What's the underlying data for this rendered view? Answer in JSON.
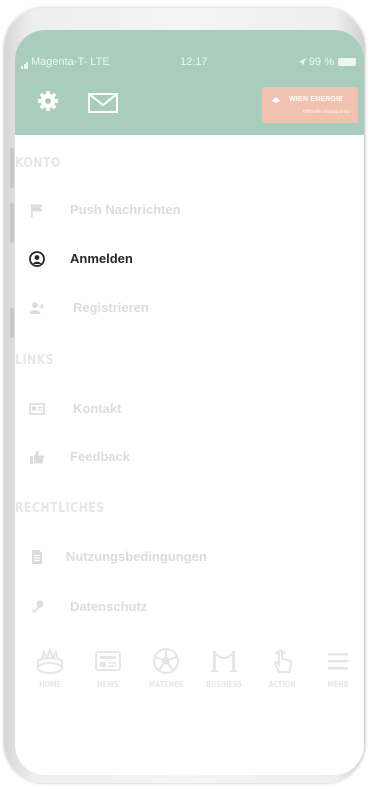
{
  "status_bar": {
    "carrier": "Magenta-T- LTE",
    "time": "12:17",
    "battery": "99 %"
  },
  "header": {
    "sponsor_logo": {
      "name": "WIEN ENERGIE",
      "subtitle": "Offizieller Hauptsponsor"
    }
  },
  "menu": {
    "sections": [
      {
        "title": "KONTO",
        "items": [
          {
            "label": "Push Nachrichten",
            "icon": "flag-icon",
            "active": false
          },
          {
            "label": "Anmelden",
            "icon": "user-circle-icon",
            "active": true
          },
          {
            "label": "Registrieren",
            "icon": "add-user-icon",
            "active": false
          }
        ]
      },
      {
        "title": "LINKS",
        "items": [
          {
            "label": "Kontakt",
            "icon": "contact-card-icon",
            "active": false
          },
          {
            "label": "Feedback",
            "icon": "thumbs-up-icon",
            "active": false
          }
        ]
      },
      {
        "title": "RECHTLICHES",
        "items": [
          {
            "label": "Nutzungsbedingungen",
            "icon": "document-icon",
            "active": false
          },
          {
            "label": "Datenschutz",
            "icon": "key-icon",
            "active": false
          }
        ]
      }
    ]
  },
  "tabbar": [
    {
      "label": "HOME",
      "icon": "stadium-icon"
    },
    {
      "label": "NEWS",
      "icon": "newspaper-icon"
    },
    {
      "label": "MATCHES",
      "icon": "soccer-ball-icon"
    },
    {
      "label": "BUSINESS",
      "icon": "barrier-rope-icon"
    },
    {
      "label": "ACTION",
      "icon": "tap-hand-icon"
    },
    {
      "label": "MEHR",
      "icon": "hamburger-menu-icon"
    }
  ],
  "colors": {
    "header_bg": "#a9cdbd",
    "active_text": "#262626",
    "inactive_text": "#dcdcdc",
    "logo_bg": "#f1c2b0"
  }
}
